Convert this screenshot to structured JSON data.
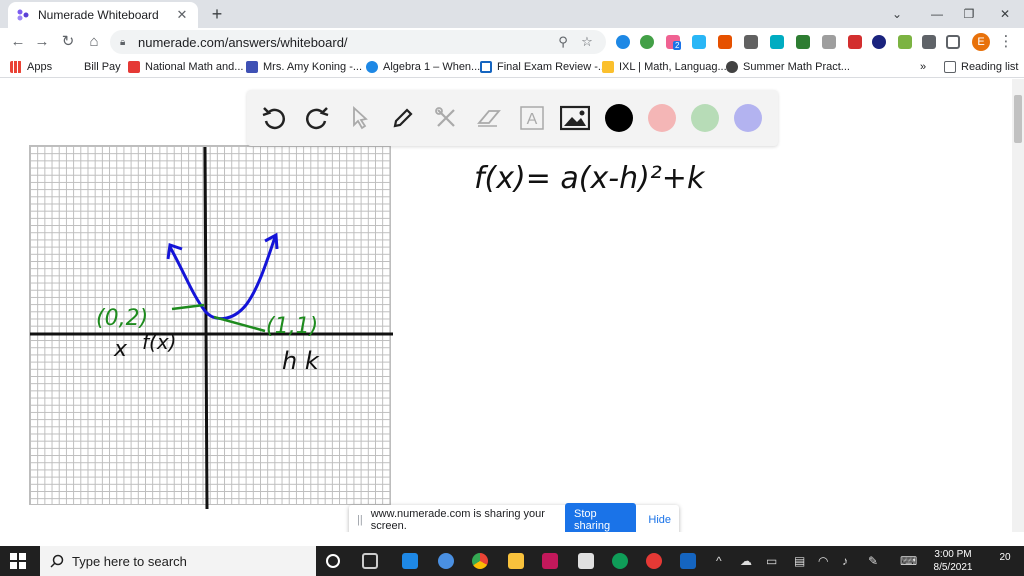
{
  "tab": {
    "title": "Numerade Whiteboard",
    "close": "✕",
    "new_tab": "+"
  },
  "window": {
    "minimize": "—",
    "restore": "❐",
    "close": "✕",
    "tab_search": "⌄"
  },
  "toolbar": {
    "back": "←",
    "forward": "→",
    "reload": "↻",
    "home": "⌂",
    "url": "numerade.com/answers/whiteboard/",
    "profile_initial": "E",
    "ext_badge": "2"
  },
  "bookmarks": {
    "items": [
      {
        "label": "Apps",
        "icon": "apps-grid-icon",
        "color": "#4285f4"
      },
      {
        "label": "Bill Pay",
        "icon": "blank-icon",
        "color": "#ffffff"
      },
      {
        "label": "National Math and...",
        "icon": "x-logo-icon",
        "color": "#e53935"
      },
      {
        "label": "Mrs. Amy Koning -...",
        "icon": "calendar-icon",
        "color": "#3f51b5"
      },
      {
        "label": "Algebra 1 – When...",
        "icon": "globe-icon",
        "color": "#1e88e5"
      },
      {
        "label": "Final Exam Review -...",
        "icon": "doc-icon",
        "color": "#1565c0"
      },
      {
        "label": "IXL | Math, Languag...",
        "icon": "ixl-icon",
        "color": "#fbc02d"
      },
      {
        "label": "Summer Math Pract...",
        "icon": "circle-icon",
        "color": "#424242"
      }
    ],
    "more": "»",
    "reading_list": "Reading list"
  },
  "whiteboard": {
    "tools": [
      "undo-icon",
      "redo-icon",
      "pointer-icon",
      "pen-icon",
      "tools-icon",
      "eraser-icon",
      "text-icon",
      "image-icon"
    ],
    "text_tool": "A",
    "colors": [
      "#000000",
      "#f4b6b6",
      "#b7dcb7",
      "#b3b3f0"
    ],
    "equation": "f(x)= a(x-h)²+k",
    "handwriting": {
      "point_left": "(0,2)",
      "point_right": "(1,1)",
      "label_x": "x",
      "label_fx": "f(x)",
      "label_hk": "h k"
    }
  },
  "share_bar": {
    "grip": "||",
    "message": "www.numerade.com is sharing your screen.",
    "stop": "Stop sharing",
    "hide": "Hide"
  },
  "taskbar": {
    "search_placeholder": "Type here to search",
    "time": "3:00 PM",
    "date": "8/5/2021",
    "notifications": "20",
    "up_arrow": "^"
  }
}
